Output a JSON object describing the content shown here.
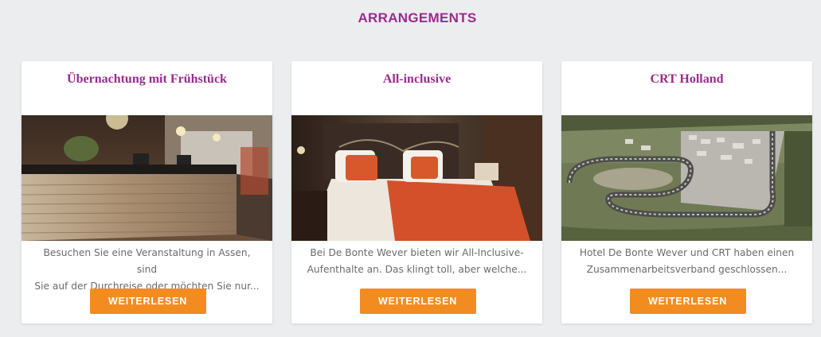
{
  "section": {
    "title": "ARRANGEMENTS"
  },
  "cards": [
    {
      "title": "Übernachtung mit Frühstück",
      "image": "hotel-reception-photo",
      "text_line1": "Besuchen Sie eine Veranstaltung in Assen, sind",
      "text_line2": "Sie auf der Durchreise oder möchten Sie nur...",
      "button_label": "WEITERLESEN"
    },
    {
      "title": "All-inclusive",
      "image": "hotel-room-photo",
      "text_line1": "Bei De Bonte Wever bieten wir All-Inclusive-",
      "text_line2": "Aufenthalte an. Das klingt toll, aber welche...",
      "button_label": "WEITERLESEN"
    },
    {
      "title": "CRT Holland",
      "image": "race-circuit-aerial-photo",
      "text_line1": "Hotel De Bonte Wever und CRT haben einen",
      "text_line2": "Zusammenarbeitsverband geschlossen...",
      "button_label": "WEITERLESEN"
    }
  ],
  "colors": {
    "title_purple": "#9b2a8e",
    "button_orange": "#f28c21",
    "background": "#ecedef"
  }
}
